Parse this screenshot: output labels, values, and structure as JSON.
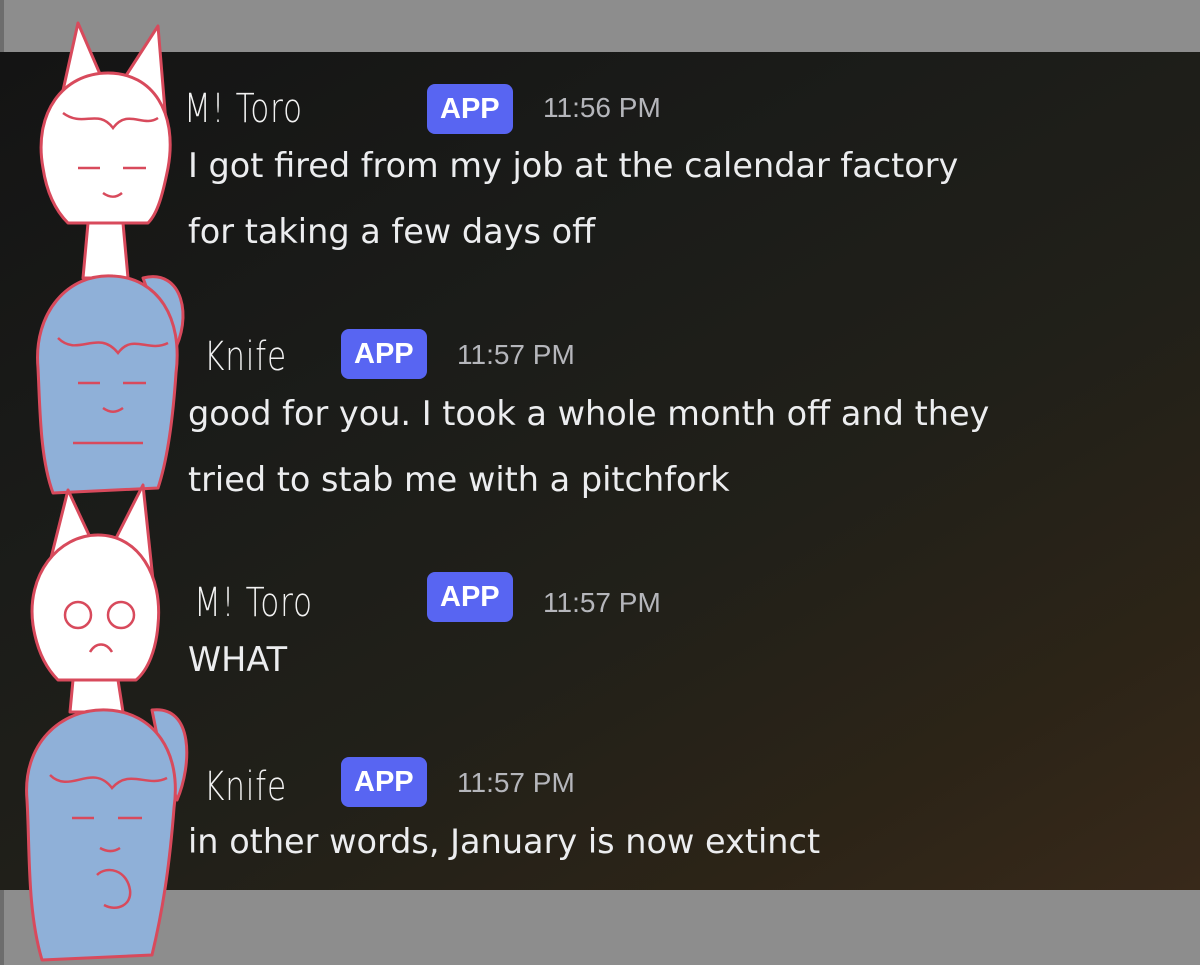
{
  "chat": {
    "accent_color": "#5865f2",
    "messages": [
      {
        "author": "M! Toro",
        "badge": "APP",
        "time": "11:56 PM",
        "lines": [
          "I got fired from my job at the calendar factory",
          "for taking a few days off"
        ],
        "avatar_icon": "fox-ear-character-avatar-icon"
      },
      {
        "author": "Knife",
        "badge": "APP",
        "time": "11:57 PM",
        "lines": [
          "good for you. I took a whole month off and they",
          "tried to stab me with a pitchfork"
        ],
        "avatar_icon": "ponytail-character-avatar-icon"
      },
      {
        "author": "M! Toro",
        "badge": "APP",
        "time": "11:57 PM",
        "lines": [
          "WHAT"
        ],
        "avatar_icon": "fox-ear-character-shocked-avatar-icon"
      },
      {
        "author": "Knife",
        "badge": "APP",
        "time": "11:57 PM",
        "lines": [
          "in other words, January is now extinct"
        ],
        "avatar_icon": "ponytail-character-thumbsup-avatar-icon"
      }
    ]
  }
}
